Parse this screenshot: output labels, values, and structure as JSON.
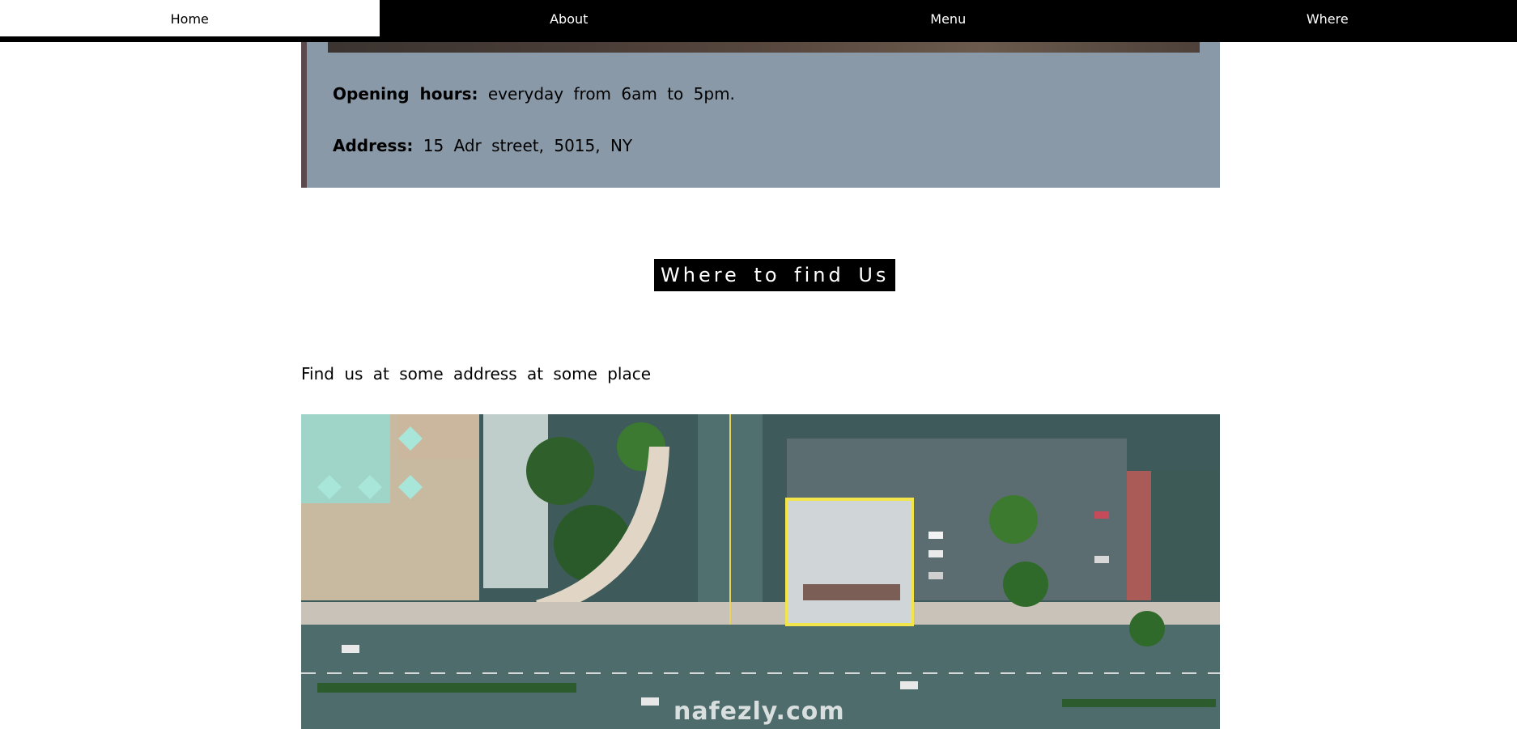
{
  "nav": {
    "items": [
      {
        "label": "Home",
        "active": true
      },
      {
        "label": "About",
        "active": false
      },
      {
        "label": "Menu",
        "active": false
      },
      {
        "label": "Where",
        "active": false
      }
    ]
  },
  "info": {
    "hours_label": "Opening hours:",
    "hours_value": "everyday from 6am to 5pm.",
    "address_label": "Address:",
    "address_value": "15 Adr street, 5015, NY"
  },
  "where": {
    "heading": "Where to find Us",
    "text": "Find us at some address at some place"
  },
  "map": {
    "watermark_text": "nafezly.com",
    "highlight_color": "#f2e54b"
  },
  "colors": {
    "nav_bg": "#000000",
    "panel_bg": "#8a99a8",
    "panel_border": "#5b4a4d"
  }
}
